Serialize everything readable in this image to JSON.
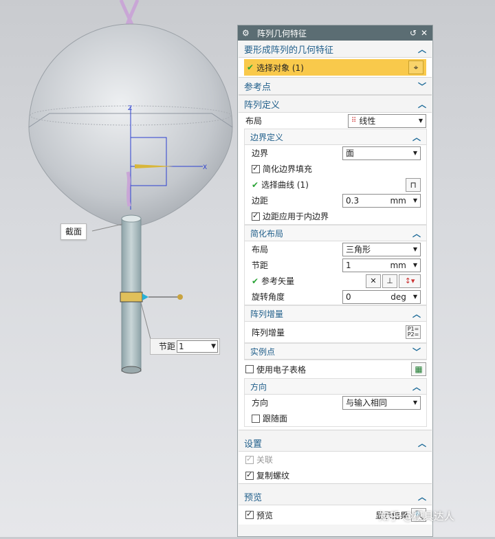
{
  "viewport": {
    "tag_section": "截面",
    "pitch_label": "节距",
    "pitch_value": "1"
  },
  "dialog": {
    "title": "阵列几何特征",
    "geometry_group": {
      "title": "要形成阵列的几何特征",
      "select_label": "选择对象 (1)"
    },
    "reference_point": {
      "title": "参考点"
    },
    "array_def": {
      "title": "阵列定义",
      "layout_label": "布局",
      "layout_value": "线性",
      "boundary": {
        "title": "边界定义",
        "boundary_label": "边界",
        "boundary_value": "面",
        "simplify_fill_label": "简化边界填充",
        "select_curve_label": "选择曲线 (1)",
        "margin_label": "边距",
        "margin_value": "0.3",
        "margin_unit": "mm",
        "apply_inner_label": "边距应用于内边界"
      },
      "simplified_layout": {
        "title": "简化布局",
        "layout_label": "布局",
        "layout_value": "三角形",
        "pitch_label": "节距",
        "pitch_value": "1",
        "pitch_unit": "mm",
        "ref_vector_label": "参考矢量",
        "rotation_label": "旋转角度",
        "rotation_value": "0",
        "rotation_unit": "deg"
      },
      "increment": {
        "title": "阵列增量",
        "label": "阵列增量"
      },
      "instance_point": {
        "title": "实例点"
      },
      "spreadsheet_label": "使用电子表格",
      "direction": {
        "title": "方向",
        "label": "方向",
        "value": "与输入相同",
        "follow_face_label": "跟随面"
      }
    },
    "settings": {
      "title": "设置",
      "associative_label": "关联",
      "copy_threads_label": "复制螺纹"
    },
    "preview": {
      "title": "预览",
      "preview_label": "预览",
      "show_result_label": "显示结果"
    }
  },
  "watermark": "知乎 @模具达人"
}
